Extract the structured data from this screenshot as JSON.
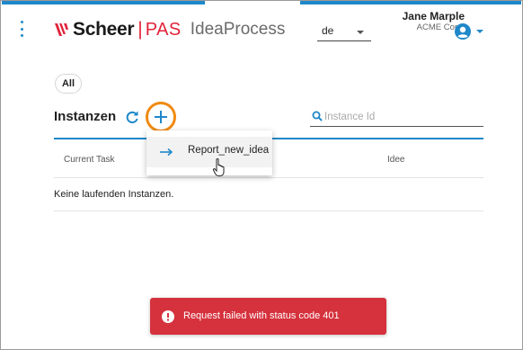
{
  "header": {
    "brand": "Scheer",
    "separator": "|",
    "product": "PAS",
    "app_name": "IdeaProcess",
    "language": {
      "selected": "de"
    },
    "user": {
      "name": "Jane Marple",
      "organization": "ACME Corp."
    }
  },
  "filter": {
    "chip_label": "All"
  },
  "section": {
    "title": "Instanzen",
    "search_placeholder": "Instance Id"
  },
  "table": {
    "columns": [
      "Current Task",
      "Idee"
    ],
    "empty_message": "Keine laufenden Instanzen."
  },
  "add_menu": {
    "items": [
      {
        "label": "Report_new_idea",
        "icon": "arrow-right-icon"
      }
    ]
  },
  "toast": {
    "message": "Request failed with status code 401",
    "icon": "alert-circle-icon"
  },
  "colors": {
    "accent": "#1f88c9",
    "brand_red": "#e0233b",
    "highlight_ring": "#f08a12",
    "error_toast": "#d5323d"
  }
}
